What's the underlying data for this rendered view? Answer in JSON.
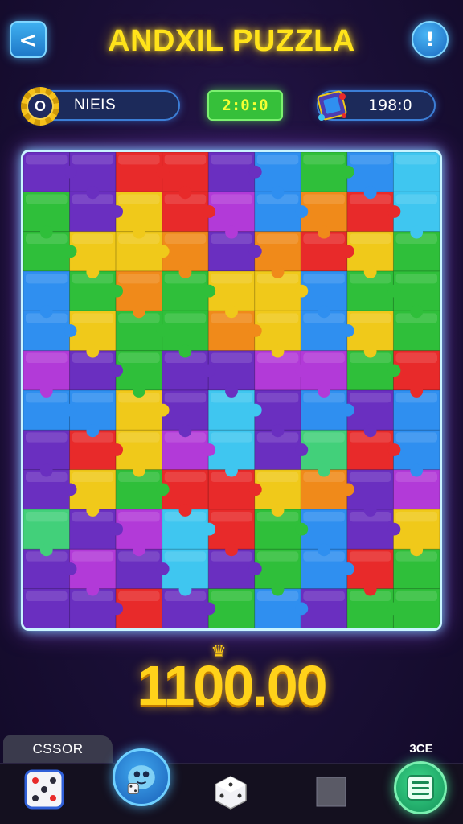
{
  "header": {
    "back_icon": "chevron-left-icon",
    "back_glyph": "<",
    "title": "ANDXIL PUZZLA",
    "info_icon": "info-icon",
    "info_glyph": "!"
  },
  "stats": {
    "left_badge_glyph": "O",
    "left_label": "NIEIS",
    "timer": "2:0:0",
    "right_value": "198:0"
  },
  "board": {
    "rows": 12,
    "cols": 9,
    "palette": [
      "#6a2fc0",
      "#2f8ff0",
      "#f0c91a",
      "#2fbf3a",
      "#e82a2a",
      "#f08a1a",
      "#b23ad8",
      "#3fc6f0",
      "#42d07a"
    ],
    "grid": [
      [
        0,
        0,
        4,
        4,
        0,
        1,
        3,
        1,
        7
      ],
      [
        3,
        0,
        2,
        4,
        6,
        1,
        5,
        4,
        7
      ],
      [
        3,
        2,
        2,
        5,
        0,
        5,
        4,
        2,
        3
      ],
      [
        1,
        3,
        5,
        3,
        2,
        2,
        1,
        3,
        3
      ],
      [
        1,
        2,
        3,
        3,
        5,
        2,
        1,
        2,
        3
      ],
      [
        6,
        0,
        3,
        0,
        0,
        6,
        6,
        3,
        4
      ],
      [
        1,
        1,
        2,
        0,
        7,
        0,
        1,
        0,
        1
      ],
      [
        0,
        4,
        2,
        6,
        7,
        0,
        8,
        4,
        1
      ],
      [
        0,
        2,
        3,
        4,
        4,
        2,
        5,
        0,
        6
      ],
      [
        8,
        0,
        6,
        7,
        4,
        3,
        1,
        0,
        2
      ],
      [
        0,
        6,
        0,
        7,
        0,
        3,
        1,
        4,
        3
      ],
      [
        0,
        0,
        4,
        0,
        3,
        1,
        0,
        3,
        3
      ]
    ]
  },
  "score": {
    "crown_glyph": "♛",
    "value": "1100.00"
  },
  "bottom": {
    "left_label": "CSSOR",
    "right_label": "3CE",
    "nav_icons": [
      "dice-icon",
      "mascot-icon",
      "white-dice-icon",
      "stop-square-icon",
      "menu-icon"
    ]
  }
}
